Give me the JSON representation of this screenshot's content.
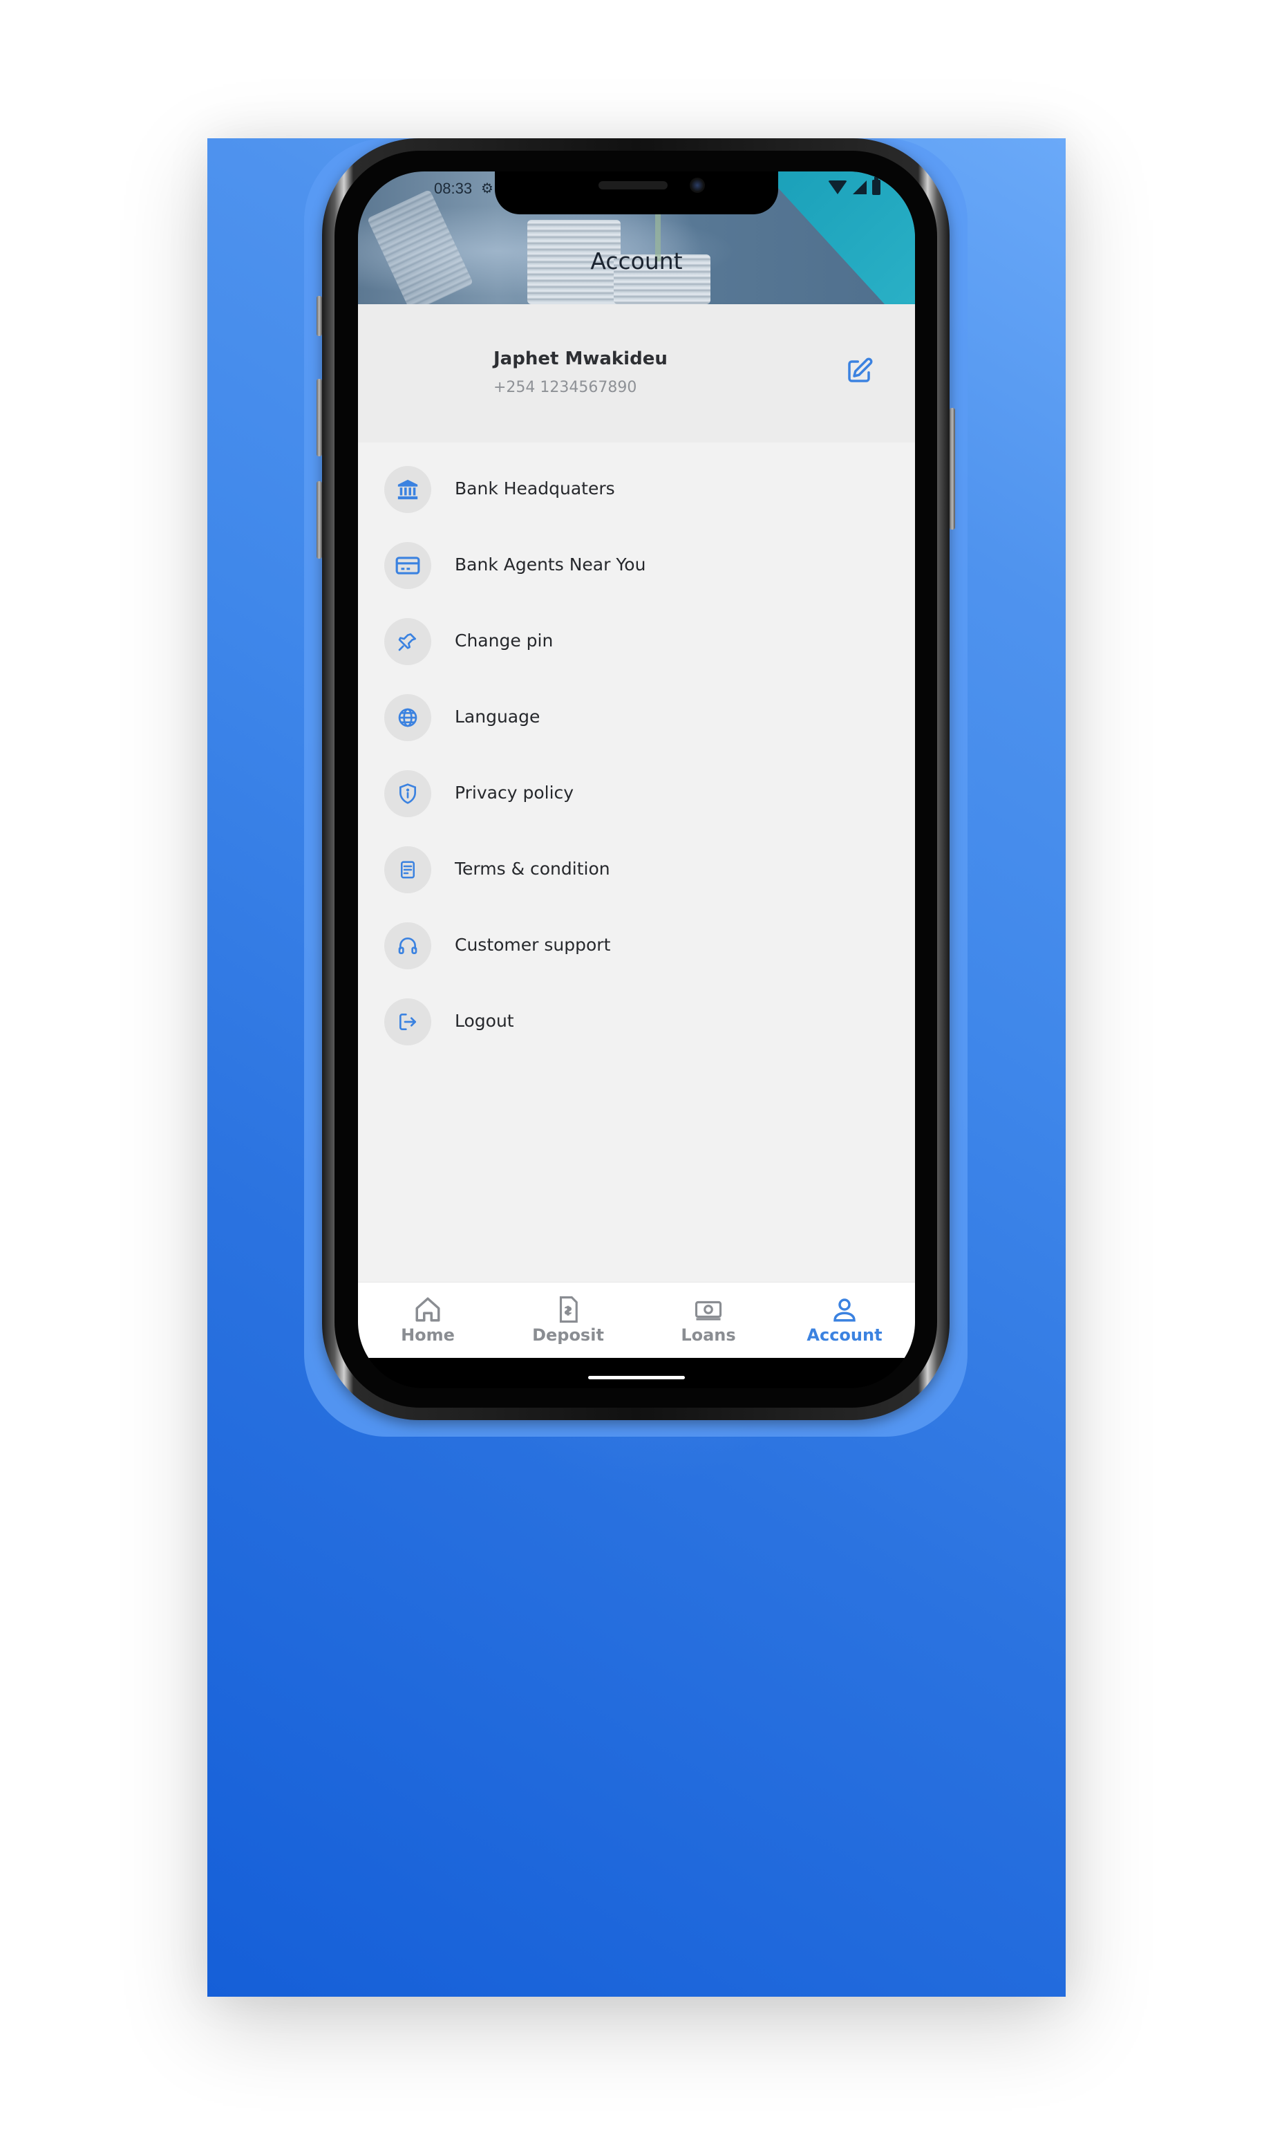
{
  "status_bar": {
    "time": "08:33",
    "gear_icon": "gear-icon",
    "icons": [
      "wifi-icon",
      "signal-icon",
      "battery-icon"
    ]
  },
  "header": {
    "title": "Account"
  },
  "profile": {
    "name": "Japhet Mwakideu",
    "phone": "+254 1234567890",
    "edit_icon": "edit-icon"
  },
  "menu": {
    "items": [
      {
        "label": "Bank Headquaters",
        "icon": "bank-icon"
      },
      {
        "label": "Bank Agents Near You",
        "icon": "credit-card-icon"
      },
      {
        "label": "Change pin",
        "icon": "pin-icon"
      },
      {
        "label": "Language",
        "icon": "globe-icon"
      },
      {
        "label": "Privacy policy",
        "icon": "shield-icon"
      },
      {
        "label": "Terms & condition",
        "icon": "document-icon"
      },
      {
        "label": "Customer support",
        "icon": "headset-icon"
      },
      {
        "label": "Logout",
        "icon": "logout-icon"
      }
    ]
  },
  "bottom_nav": {
    "items": [
      {
        "label": "Home",
        "icon": "home-icon",
        "active": false
      },
      {
        "label": "Deposit",
        "icon": "deposit-icon",
        "active": false
      },
      {
        "label": "Loans",
        "icon": "cash-icon",
        "active": false
      },
      {
        "label": "Account",
        "icon": "user-icon",
        "active": true
      }
    ]
  },
  "colors": {
    "accent": "#3b82e0",
    "inactive": "#8a8d92",
    "background_gradient_start": "#6aa9f8",
    "background_gradient_end": "#155fd8",
    "header_teal": "#2ab0c6"
  }
}
